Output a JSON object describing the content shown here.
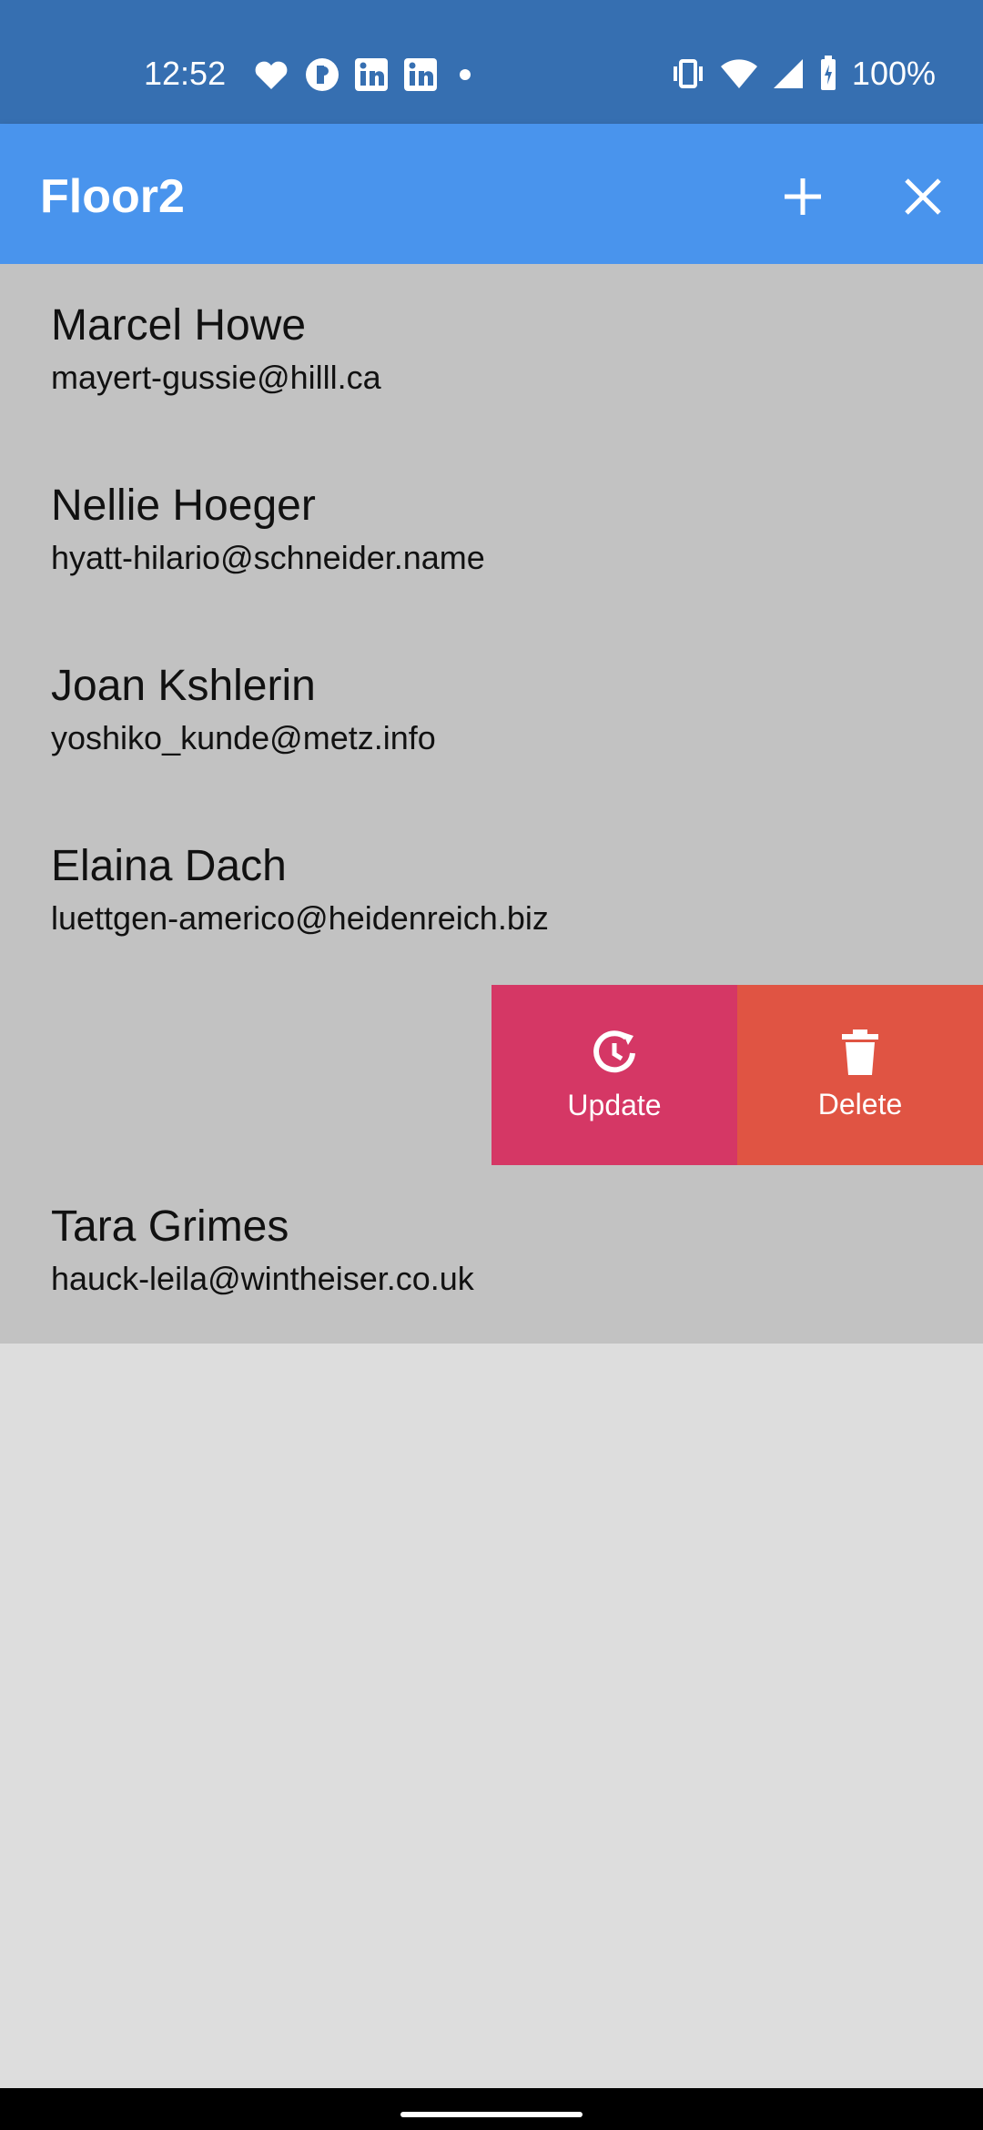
{
  "status_bar": {
    "time": "12:52",
    "battery": "100%",
    "notification_icons": [
      "iheartradio-icon",
      "podcast-icon",
      "linkedin-icon",
      "linkedin-icon",
      "dot-icon"
    ]
  },
  "app_bar": {
    "title": "Floor2",
    "add_icon": "plus-icon",
    "close_icon": "close-icon"
  },
  "contacts": [
    {
      "name": "Marcel Howe",
      "email": "mayert-gussie@hilll.ca"
    },
    {
      "name": "Nellie Hoeger",
      "email": "hyatt-hilario@schneider.name"
    },
    {
      "name": "Joan Kshlerin",
      "email": "yoshiko_kunde@metz.info"
    },
    {
      "name": "Elaina Dach",
      "email": "luettgen-americo@heidenreich.biz"
    },
    {
      "name": "",
      "email": ""
    },
    {
      "name": "Tara Grimes",
      "email": "hauck-leila@wintheiser.co.uk"
    }
  ],
  "swipe_actions": {
    "update_label": "Update",
    "delete_label": "Delete"
  },
  "colors": {
    "status_bar": "#366fb1",
    "app_bar": "#4994ed",
    "list_bg": "#c2c2c2",
    "page_bg": "#dddddd",
    "update": "#d53765",
    "delete": "#e05443"
  }
}
